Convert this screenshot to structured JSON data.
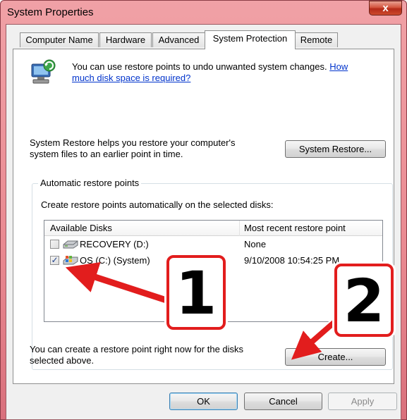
{
  "window": {
    "title": "System Properties",
    "close_glyph": "x"
  },
  "tabs": [
    {
      "label": "Computer Name"
    },
    {
      "label": "Hardware"
    },
    {
      "label": "Advanced"
    },
    {
      "label": "System Protection",
      "active": true
    },
    {
      "label": "Remote"
    }
  ],
  "intro": {
    "text": "You can use restore points to undo unwanted system changes.",
    "link_part1": "How",
    "link_part2": "much disk space is required?"
  },
  "restore": {
    "description_line1": "System Restore helps you restore your computer's",
    "description_line2": "system files to an earlier point in time.",
    "button": "System Restore..."
  },
  "auto": {
    "group_label": "Automatic restore points",
    "instructions": "Create restore points automatically on the selected disks:",
    "columns": [
      "Available Disks",
      "Most recent restore point"
    ],
    "disks": [
      {
        "name": "RECOVERY (D:)",
        "checked": false,
        "recent": "None"
      },
      {
        "name": "OS (C:) (System)",
        "checked": true,
        "recent": "9/10/2008 10:54:25 PM"
      }
    ]
  },
  "create": {
    "description_line1": "You can create a restore point right now for the disks",
    "description_line2": "selected above.",
    "button": "Create..."
  },
  "footer": {
    "ok": "OK",
    "cancel": "Cancel",
    "apply": "Apply"
  },
  "annotations": {
    "callout_1": "1",
    "callout_2": "2",
    "arrow_color": "#e21d1d"
  }
}
